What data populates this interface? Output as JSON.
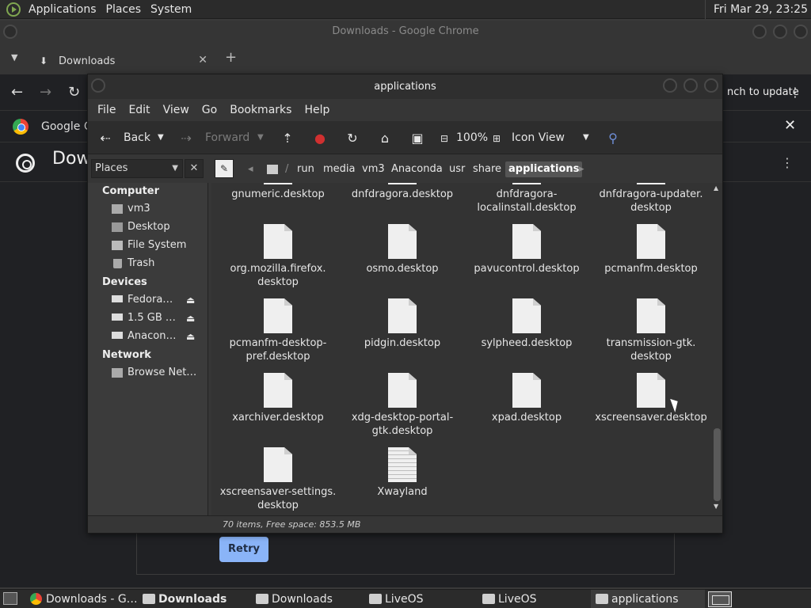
{
  "top_panel": {
    "menus": [
      "Applications",
      "Places",
      "System"
    ],
    "clock": "Fri Mar 29, 23:25"
  },
  "chrome": {
    "window_title": "Downloads - Google Chrome",
    "tab_label": "Downloads",
    "update_label": "nch to update",
    "infobar_text": "Google C",
    "page_title": "Dow",
    "retry_label": "Retry"
  },
  "file_manager": {
    "window_title": "applications",
    "menus": [
      "File",
      "Edit",
      "View",
      "Go",
      "Bookmarks",
      "Help"
    ],
    "toolbar": {
      "back": "Back",
      "forward": "Forward",
      "zoom": "100%",
      "view_mode": "Icon View"
    },
    "side_pane_select": "Places",
    "breadcrumbs": [
      "run",
      "media",
      "vm3",
      "Anaconda",
      "usr",
      "share",
      "applications"
    ],
    "sidebar": {
      "computer_heading": "Computer",
      "computer_items": [
        "vm3",
        "Desktop",
        "File System",
        "Trash"
      ],
      "devices_heading": "Devices",
      "device_items": [
        "Fedora…",
        "1.5 GB …",
        "Anacon…"
      ],
      "network_heading": "Network",
      "network_items": [
        "Browse Net…"
      ]
    },
    "files": [
      {
        "name": "gnumeric.desktop",
        "lines": [
          "gnumeric.desktop"
        ]
      },
      {
        "name": "dnfdragora.desktop",
        "lines": [
          "dnfdragora.desktop"
        ]
      },
      {
        "name": "dnfdragora-localinstall.desktop",
        "lines": [
          "dnfdragora-",
          "localinstall.desktop"
        ]
      },
      {
        "name": "dnfdragora-updater.desktop",
        "lines": [
          "dnfdragora-updater.",
          "desktop"
        ]
      },
      {
        "name": "org.mozilla.firefox.desktop",
        "lines": [
          "org.mozilla.firefox.",
          "desktop"
        ]
      },
      {
        "name": "osmo.desktop",
        "lines": [
          "osmo.desktop"
        ]
      },
      {
        "name": "pavucontrol.desktop",
        "lines": [
          "pavucontrol.desktop"
        ]
      },
      {
        "name": "pcmanfm.desktop",
        "lines": [
          "pcmanfm.desktop"
        ]
      },
      {
        "name": "pcmanfm-desktop-pref.desktop",
        "lines": [
          "pcmanfm-desktop-",
          "pref.desktop"
        ]
      },
      {
        "name": "pidgin.desktop",
        "lines": [
          "pidgin.desktop"
        ]
      },
      {
        "name": "sylpheed.desktop",
        "lines": [
          "sylpheed.desktop"
        ]
      },
      {
        "name": "transmission-gtk.desktop",
        "lines": [
          "transmission-gtk.",
          "desktop"
        ]
      },
      {
        "name": "xarchiver.desktop",
        "lines": [
          "xarchiver.desktop"
        ]
      },
      {
        "name": "xdg-desktop-portal-gtk.desktop",
        "lines": [
          "xdg-desktop-portal-",
          "gtk.desktop"
        ]
      },
      {
        "name": "xpad.desktop",
        "lines": [
          "xpad.desktop"
        ]
      },
      {
        "name": "xscreensaver.desktop",
        "lines": [
          "xscreensaver.desktop"
        ]
      },
      {
        "name": "xscreensaver-settings.desktop",
        "lines": [
          "xscreensaver-settings.",
          "desktop"
        ]
      },
      {
        "name": "Xwayland",
        "lines": [
          "Xwayland"
        ]
      }
    ],
    "status": "70 items, Free space: 853.5 MB"
  },
  "taskbar": {
    "tasks": [
      "Downloads - G…",
      "Downloads",
      "Downloads",
      "LiveOS",
      "LiveOS",
      "applications"
    ]
  }
}
